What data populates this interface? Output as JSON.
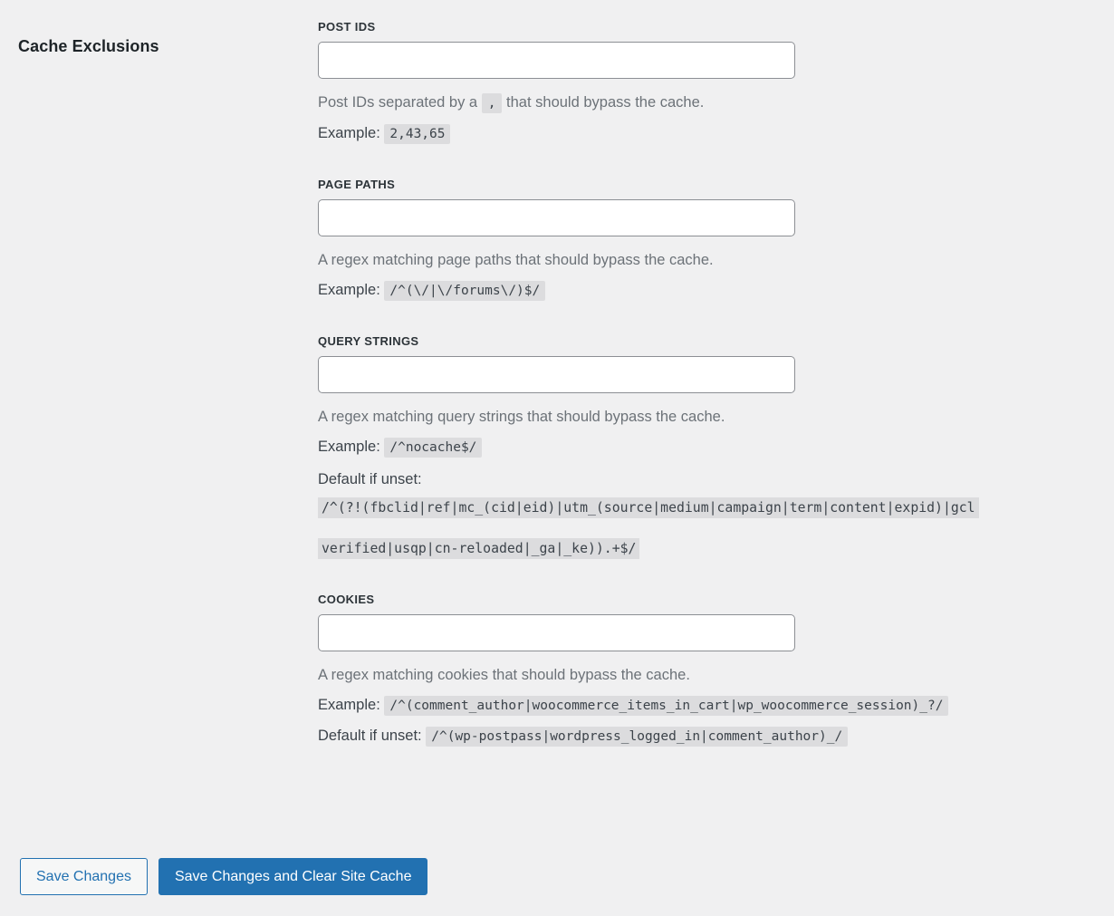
{
  "section": {
    "title": "Cache Exclusions"
  },
  "fields": [
    {
      "label": "POST IDS",
      "value": "",
      "placeholder": "",
      "help_prefix": "Post IDs separated by a",
      "help_code": ",",
      "help_suffix": "that should bypass the cache.",
      "example_label": "Example:",
      "example_code": "2,43,65"
    },
    {
      "label": "PAGE PATHS",
      "value": "",
      "placeholder": "",
      "help_text": "A regex matching page paths that should bypass the cache.",
      "example_label": "Example:",
      "example_code": "/^(\\/|\\/forums\\/)$/"
    },
    {
      "label": "QUERY STRINGS",
      "value": "",
      "placeholder": "",
      "help_text": "A regex matching query strings that should bypass the cache.",
      "example_label": "Example:",
      "example_code": "/^nocache$/",
      "default_label": "Default if unset:",
      "default_code_line1": "/^(?!(fbclid|ref|mc_(cid|eid)|utm_(source|medium|campaign|term|content|expid)|gcl",
      "default_code_line2": "verified|usqp|cn-reloaded|_ga|_ke)).+$/"
    },
    {
      "label": "COOKIES",
      "value": "",
      "placeholder": "",
      "help_text": "A regex matching cookies that should bypass the cache.",
      "example_label": "Example:",
      "example_code": "/^(comment_author|woocommerce_items_in_cart|wp_woocommerce_session)_?/",
      "default_label": "Default if unset:",
      "default_code_inline": "/^(wp-postpass|wordpress_logged_in|comment_author)_/"
    }
  ],
  "actions": {
    "save_label": "Save Changes",
    "save_clear_label": "Save Changes and Clear Site Cache"
  },
  "colors": {
    "page_background": "#f0f0f1",
    "accent": "#2271b1",
    "code_background": "#dcdcde",
    "help_text": "#6c7278",
    "heading": "#1d2327"
  }
}
